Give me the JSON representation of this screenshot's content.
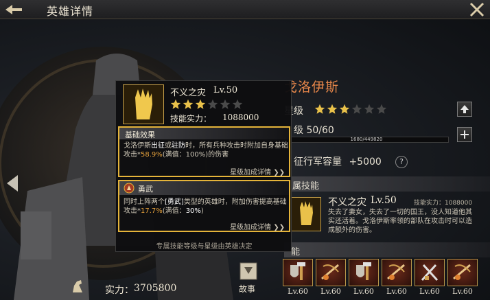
{
  "header": {
    "title": "英雄详情"
  },
  "hero": {
    "name": "戈洛伊斯"
  },
  "stats": {
    "star_label": "星级",
    "star_rating": 3,
    "star_max": 6,
    "level_label": "级 50/60",
    "exp_text": "1680/449820",
    "exp_fraction": 0.0037,
    "march_label": "征行军容量",
    "march_value": "+5000",
    "help_text": "?"
  },
  "sections": {
    "skill_header": "属技能",
    "troop_header": "能"
  },
  "skill": {
    "name": "不义之灾",
    "level": "Lv.50",
    "power_text": "技能实力：1088000",
    "description": "失去了妻女，失去了一切的国王，没人知道他其实还活着。戈洛伊斯率领的部队在攻击时可以造成额外的伤害。"
  },
  "popup": {
    "name": "不义之灾",
    "level": "Lv.50",
    "star_rating": 3,
    "star_max": 6,
    "power_label": "技能实力：",
    "power_value": "1088000",
    "base_effect": {
      "title": "基础效果",
      "text_parts": [
        "戈洛伊斯",
        "出征",
        "或",
        "驻防",
        "时，所有兵种攻击时附加自身基础攻击*",
        "58.9%",
        "(满值：100%)的伤害"
      ],
      "link": "星级加成详情"
    },
    "brave": {
      "title": "勇武",
      "text_parts": [
        "同时上阵两个",
        "[勇武]",
        "类型的英雄时，附加伤害提高基础攻击*",
        "17.7%",
        "(满值：",
        "30%",
        ")"
      ],
      "link": "星级加成详情"
    },
    "footer": "专属技能等级与星级由英雄决定"
  },
  "troops": [
    {
      "icon": "shield-hammer-icon",
      "level": "Lv.60"
    },
    {
      "icon": "crossbow-icon",
      "level": "Lv.60"
    },
    {
      "icon": "shield-hammer-icon",
      "level": "Lv.60"
    },
    {
      "icon": "crossbow-icon",
      "level": "Lv.60"
    },
    {
      "icon": "sword-cross-icon",
      "level": "Lv.60"
    },
    {
      "icon": "crossbow-icon",
      "level": "Lv.60"
    }
  ],
  "bottom": {
    "story_label": "故事",
    "power_label": "实力：",
    "power_value": "3705800"
  }
}
